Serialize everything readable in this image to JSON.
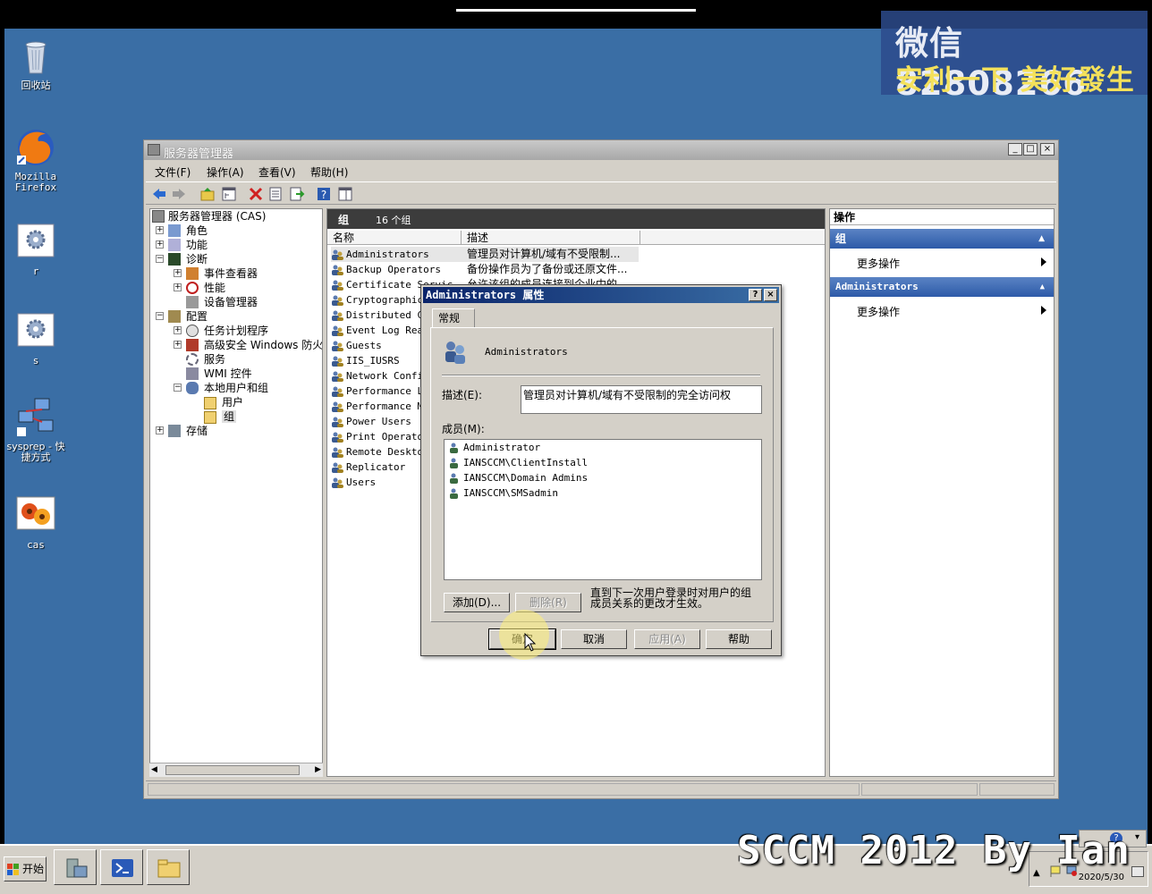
{
  "desktop": {
    "icons": [
      {
        "label": "回收站"
      },
      {
        "label": "Mozilla Firefox"
      },
      {
        "label": "r"
      },
      {
        "label": "s"
      },
      {
        "label": "sysprep - 快捷方式"
      },
      {
        "label": "cas"
      }
    ]
  },
  "watermark": {
    "line1": "微信 82808266",
    "line2": "安利一下 美好發生"
  },
  "window": {
    "title": "服务器管理器",
    "menus": [
      "文件(F)",
      "操作(A)",
      "查看(V)",
      "帮助(H)"
    ]
  },
  "tree": {
    "root": "服务器管理器 (CAS)",
    "items": [
      "角色",
      "功能",
      "诊断",
      "事件查看器",
      "性能",
      "设备管理器",
      "配置",
      "任务计划程序",
      "高级安全 Windows 防火墙",
      "服务",
      "WMI 控件",
      "本地用户和组",
      "用户",
      "组",
      "存储"
    ]
  },
  "center": {
    "header_title": "组",
    "header_count": "16 个组",
    "col_name": "名称",
    "col_desc": "描述",
    "groups": [
      "Administrators",
      "Backup Operators",
      "Certificate Servic",
      "Cryptographic",
      "Distributed CO",
      "Event Log Read",
      "Guests",
      "IIS_IUSRS",
      "Network Config",
      "Performance Lo",
      "Performance Mo",
      "Power Users",
      "Print Operator",
      "Remote Desktop",
      "Replicator",
      "Users"
    ],
    "descriptions": [
      "管理员对计算机/域有不受限制...",
      "备份操作员为了备份或还原文件...",
      "允许该组的成员连接到企业中的"
    ]
  },
  "actions": {
    "title": "操作",
    "section1": "组",
    "section1_item": "更多操作",
    "section2": "Administrators",
    "section2_item": "更多操作"
  },
  "dialog": {
    "title": "Administrators 属性",
    "tab": "常规",
    "group_name": "Administrators",
    "desc_label": "描述(E):",
    "desc_value": "管理员对计算机/域有不受限制的完全访问权",
    "members_label": "成员(M):",
    "members": [
      "Administrator",
      "IANSCCM\\ClientInstall",
      "IANSCCM\\Domain Admins",
      "IANSCCM\\SMSadmin"
    ],
    "add_btn": "添加(D)...",
    "remove_btn": "删除(R)",
    "note": "直到下一次用户登录时对用户的组成员关系的更改才生效。",
    "ok_btn": "确定",
    "cancel_btn": "取消",
    "apply_btn": "应用(A)",
    "help_btn": "帮助"
  },
  "taskbar": {
    "start": "开始",
    "clock": "2020/5/30"
  },
  "overlay_text": "SCCM 2012 By Ian",
  "colors": {
    "desktop": "#3a6ea5",
    "dialog_title": "#0a246a",
    "action_header": "#2d5aa8"
  }
}
